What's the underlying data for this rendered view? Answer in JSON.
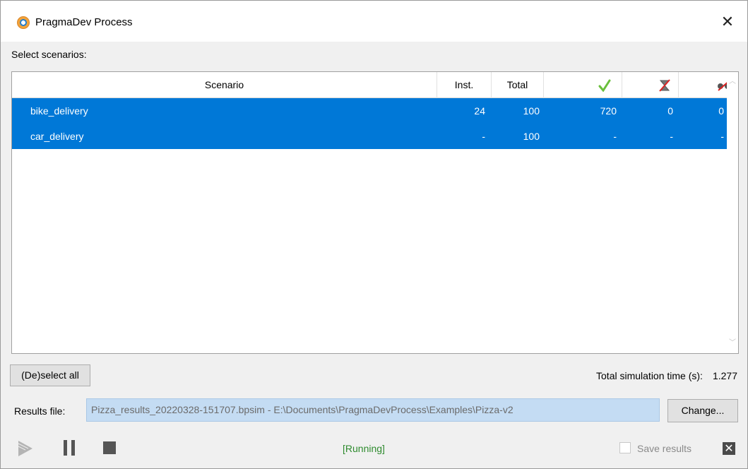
{
  "window": {
    "title": "PragmaDev Process"
  },
  "select_label": "Select scenarios:",
  "table": {
    "headers": {
      "scenario": "Scenario",
      "inst": "Inst.",
      "total": "Total"
    },
    "rows": [
      {
        "scenario": "bike_delivery",
        "inst": "24",
        "total": "100",
        "success": "720",
        "failed": "0",
        "inconclusive": "0"
      },
      {
        "scenario": "car_delivery",
        "inst": "-",
        "total": "100",
        "success": "-",
        "failed": "-",
        "inconclusive": "-"
      }
    ]
  },
  "buttons": {
    "deselect_all": "(De)select all",
    "change": "Change..."
  },
  "sim_time": {
    "label": "Total simulation time (s):",
    "value": "1.277"
  },
  "results": {
    "label": "Results file:",
    "value": "Pizza_results_20220328-151707.bpsim - E:\\Documents\\PragmaDevProcess\\Examples\\Pizza-v2"
  },
  "status": "[Running]",
  "save_results": {
    "label": "Save results",
    "checked": false
  },
  "colors": {
    "selection": "#0078d7",
    "status_text": "#2e8b2e",
    "results_field": "#c4dcf3"
  }
}
